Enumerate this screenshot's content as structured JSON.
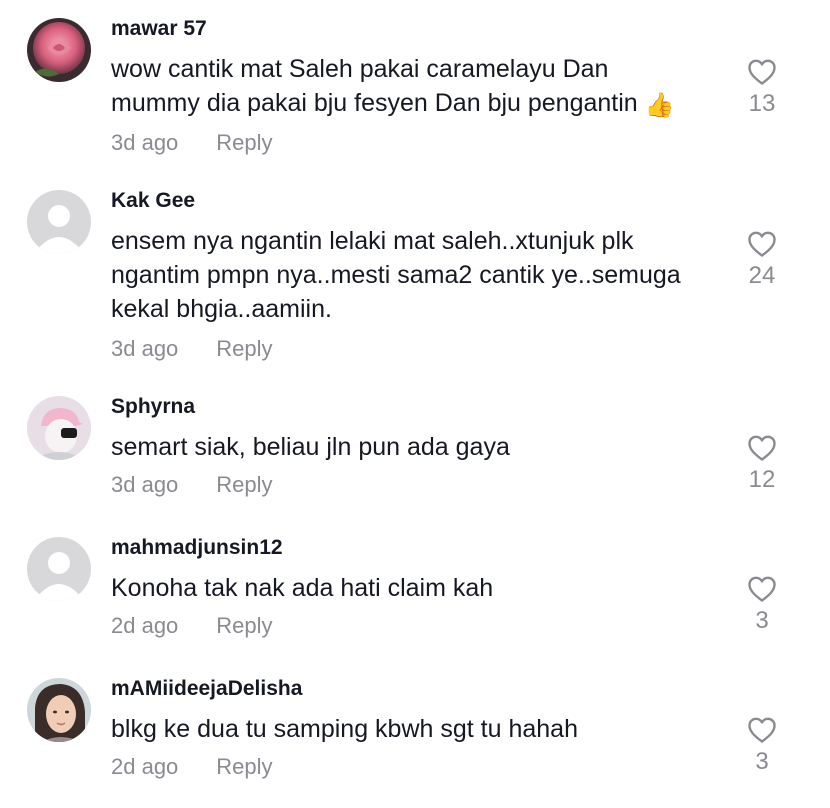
{
  "comments": [
    {
      "username": "mawar 57",
      "text": "wow cantik mat Saleh pakai caramelayu Dan\nmummy dia pakai bju fesyen Dan bju pengantin",
      "emoji": "👍",
      "date": "3d ago",
      "reply_label": "Reply",
      "likes": "13",
      "avatar": "rose-photo"
    },
    {
      "username": "Kak Gee",
      "text": "ensem nya ngantin lelaki mat saleh..xtunjuk plk\nngantim pmpn nya..mesti sama2 cantik ye..semuga\nkekal bhgia..aamiin.",
      "date": "3d ago",
      "reply_label": "Reply",
      "likes": "24",
      "avatar": "default-user"
    },
    {
      "username": "Sphyrna",
      "text": "semart siak, beliau jln pun ada gaya",
      "date": "3d ago",
      "reply_label": "Reply",
      "likes": "12",
      "avatar": "pink-cap-photo"
    },
    {
      "username": "mahmadjunsin12",
      "text": "Konoha tak nak ada hati claim kah",
      "date": "2d ago",
      "reply_label": "Reply",
      "likes": "3",
      "avatar": "default-user"
    },
    {
      "username": "mAMiideejaDelisha",
      "text": "blkg ke dua tu samping kbwh sgt tu hahah",
      "date": "2d ago",
      "reply_label": "Reply",
      "likes": "3",
      "avatar": "girl-photo"
    }
  ],
  "colors": {
    "text": "#161823",
    "muted": "#8a8b91",
    "heart_outline": "#8a8b91",
    "default_avatar_bg": "#d8d8da"
  }
}
